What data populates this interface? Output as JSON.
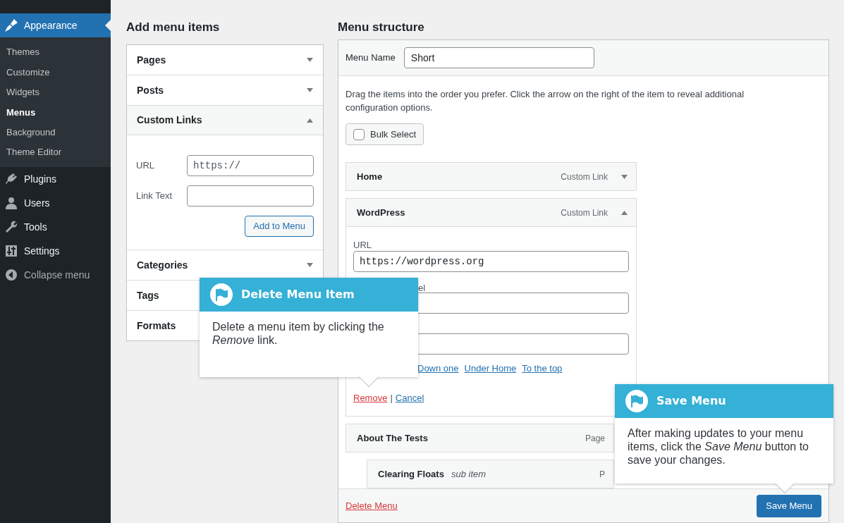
{
  "sidebar": {
    "items": [
      {
        "label": "Appearance",
        "selected": true,
        "children": [
          {
            "label": "Themes",
            "selected": false
          },
          {
            "label": "Customize",
            "selected": false
          },
          {
            "label": "Widgets",
            "selected": false
          },
          {
            "label": "Menus",
            "selected": true
          },
          {
            "label": "Background",
            "selected": false
          },
          {
            "label": "Theme Editor",
            "selected": false
          }
        ]
      },
      {
        "label": "Plugins",
        "selected": false
      },
      {
        "label": "Users",
        "selected": false
      },
      {
        "label": "Tools",
        "selected": false
      },
      {
        "label": "Settings",
        "selected": false
      },
      {
        "label": "Collapse menu",
        "selected": false
      }
    ]
  },
  "add_items": {
    "title": "Add menu items",
    "panels": [
      {
        "label": "Pages",
        "expanded": false
      },
      {
        "label": "Posts",
        "expanded": false
      },
      {
        "label": "Custom Links",
        "expanded": true,
        "url_label": "URL",
        "url_value": "https://",
        "link_text_label": "Link Text",
        "button": "Add to Menu"
      },
      {
        "label": "Categories",
        "expanded": false
      },
      {
        "label": "Tags"
      },
      {
        "label": "Formats"
      }
    ]
  },
  "structure": {
    "title": "Menu structure",
    "menu_name_label": "Menu Name",
    "menu_name_value": "Short",
    "instructions": "Drag the items into the order you prefer. Click the arrow on the right of the item to reveal additional configuration options.",
    "bulk_select": {
      "label": "Bulk Select",
      "checked": false
    },
    "items": [
      {
        "title": "Home",
        "type": "Custom Link",
        "expanded": false,
        "sub": false
      },
      {
        "title": "WordPress",
        "type": "Custom Link",
        "expanded": true,
        "sub": false,
        "url_label": "URL",
        "url_value": "https://wordpress.org",
        "label_fragment": "el",
        "move_links": [
          "Down one",
          "Under Home",
          "To the top"
        ],
        "remove": "Remove",
        "separator": "|",
        "cancel": "Cancel"
      },
      {
        "title": "About The Tests",
        "type": "Page",
        "sub": false
      },
      {
        "title": "Clearing Floats",
        "subtitle": "sub item",
        "type": "P",
        "sub": true
      }
    ],
    "delete_link": "Delete Menu",
    "save_button": "Save Menu"
  },
  "tooltips": [
    {
      "title": "Delete Menu Item",
      "body": "Delete a menu item by clicking the *Remove* link."
    },
    {
      "title": "Save Menu",
      "body": "After making updates to your menu items, click the *Save Menu* button to save your changes."
    }
  ]
}
